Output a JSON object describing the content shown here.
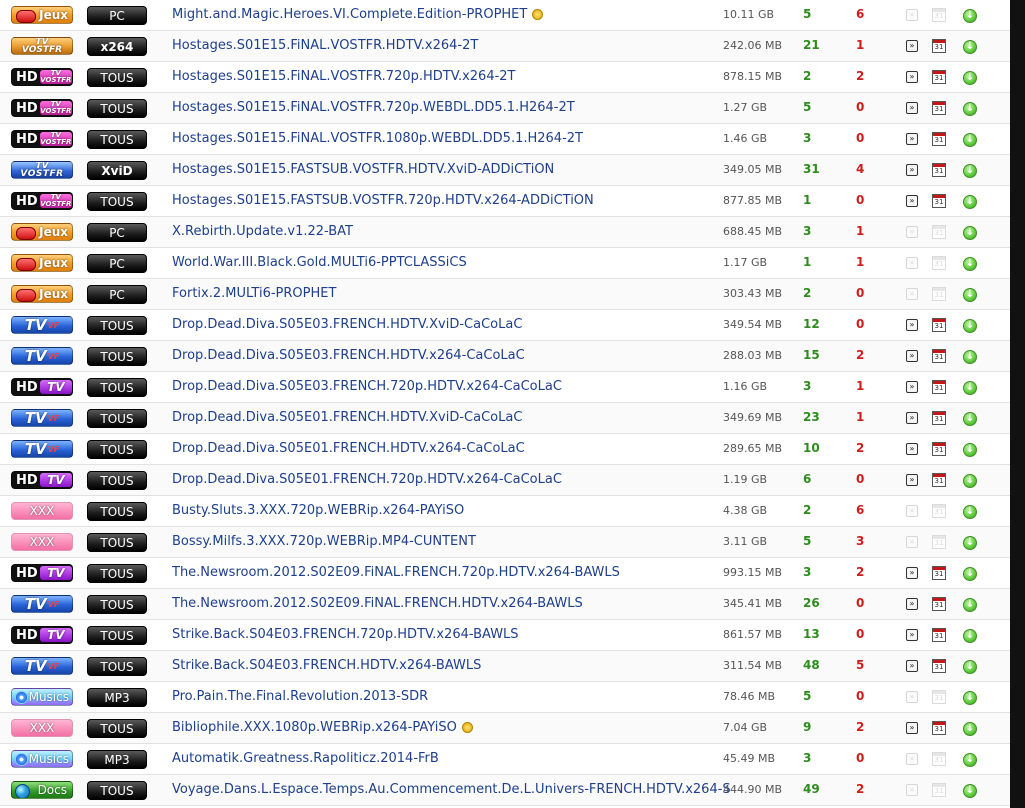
{
  "rows": [
    {
      "cat": "jeux",
      "cat_label": "Jeux",
      "sub": "PC",
      "name": "Might.and.Magic.Heroes.VI.Complete.Edition-PROPHET",
      "star": true,
      "size": "10.11 GB",
      "seeders": "5",
      "leechers": "6",
      "nfo": false
    },
    {
      "cat": "vostfr-orange",
      "cat_label": "VOSTFR",
      "sub": "x264",
      "name": "Hostages.S01E15.FiNAL.VOSTFR.HDTV.x264-2T",
      "star": false,
      "size": "242.06 MB",
      "seeders": "21",
      "leechers": "1",
      "nfo": true
    },
    {
      "cat": "hd-vostfr",
      "cat_label": "HD",
      "sub": "TOUS",
      "name": "Hostages.S01E15.FiNAL.VOSTFR.720p.HDTV.x264-2T",
      "star": false,
      "size": "878.15 MB",
      "seeders": "2",
      "leechers": "2",
      "nfo": true
    },
    {
      "cat": "hd-vostfr",
      "cat_label": "HD",
      "sub": "TOUS",
      "name": "Hostages.S01E15.FiNAL.VOSTFR.720p.WEBDL.DD5.1.H264-2T",
      "star": false,
      "size": "1.27 GB",
      "seeders": "5",
      "leechers": "0",
      "nfo": true
    },
    {
      "cat": "hd-vostfr",
      "cat_label": "HD",
      "sub": "TOUS",
      "name": "Hostages.S01E15.FiNAL.VOSTFR.1080p.WEBDL.DD5.1.H264-2T",
      "star": false,
      "size": "1.46 GB",
      "seeders": "3",
      "leechers": "0",
      "nfo": true
    },
    {
      "cat": "tvvostfr",
      "cat_label": "VOSTFR",
      "sub": "XviD",
      "name": "Hostages.S01E15.FASTSUB.VOSTFR.HDTV.XviD-ADDiCTiON",
      "star": false,
      "size": "349.05 MB",
      "seeders": "31",
      "leechers": "4",
      "nfo": true
    },
    {
      "cat": "hd-vostfr",
      "cat_label": "HD",
      "sub": "TOUS",
      "name": "Hostages.S01E15.FASTSUB.VOSTFR.720p.HDTV.x264-ADDiCTiON",
      "star": false,
      "size": "877.85 MB",
      "seeders": "1",
      "leechers": "0",
      "nfo": true
    },
    {
      "cat": "jeux",
      "cat_label": "Jeux",
      "sub": "PC",
      "name": "X.Rebirth.Update.v1.22-BAT",
      "star": false,
      "size": "688.45 MB",
      "seeders": "3",
      "leechers": "1",
      "nfo": false
    },
    {
      "cat": "jeux",
      "cat_label": "Jeux",
      "sub": "PC",
      "name": "World.War.III.Black.Gold.MULTi6-PPTCLASSiCS",
      "star": false,
      "size": "1.17 GB",
      "seeders": "1",
      "leechers": "1",
      "nfo": false
    },
    {
      "cat": "jeux",
      "cat_label": "Jeux",
      "sub": "PC",
      "name": "Fortix.2.MULTi6-PROPHET",
      "star": false,
      "size": "303.43 MB",
      "seeders": "2",
      "leechers": "0",
      "nfo": false
    },
    {
      "cat": "tv",
      "cat_label": "TV",
      "sub": "TOUS",
      "name": "Drop.Dead.Diva.S05E03.FRENCH.HDTV.XviD-CaCoLaC",
      "star": false,
      "size": "349.54 MB",
      "seeders": "12",
      "leechers": "0",
      "nfo": true
    },
    {
      "cat": "tv",
      "cat_label": "TV",
      "sub": "TOUS",
      "name": "Drop.Dead.Diva.S05E03.FRENCH.HDTV.x264-CaCoLaC",
      "star": false,
      "size": "288.03 MB",
      "seeders": "15",
      "leechers": "2",
      "nfo": true
    },
    {
      "cat": "hd-vf",
      "cat_label": "HD",
      "sub": "TOUS",
      "name": "Drop.Dead.Diva.S05E03.FRENCH.720p.HDTV.x264-CaCoLaC",
      "star": false,
      "size": "1.16 GB",
      "seeders": "3",
      "leechers": "1",
      "nfo": true
    },
    {
      "cat": "tv",
      "cat_label": "TV",
      "sub": "TOUS",
      "name": "Drop.Dead.Diva.S05E01.FRENCH.HDTV.XviD-CaCoLaC",
      "star": false,
      "size": "349.69 MB",
      "seeders": "23",
      "leechers": "1",
      "nfo": true
    },
    {
      "cat": "tv",
      "cat_label": "TV",
      "sub": "TOUS",
      "name": "Drop.Dead.Diva.S05E01.FRENCH.HDTV.x264-CaCoLaC",
      "star": false,
      "size": "289.65 MB",
      "seeders": "10",
      "leechers": "2",
      "nfo": true
    },
    {
      "cat": "hd-vf",
      "cat_label": "HD",
      "sub": "TOUS",
      "name": "Drop.Dead.Diva.S05E01.FRENCH.720p.HDTV.x264-CaCoLaC",
      "star": false,
      "size": "1.19 GB",
      "seeders": "6",
      "leechers": "0",
      "nfo": true
    },
    {
      "cat": "xxx",
      "cat_label": "XXX",
      "sub": "TOUS",
      "name": "Busty.Sluts.3.XXX.720p.WEBRip.x264-PAYiSO",
      "star": false,
      "size": "4.38 GB",
      "seeders": "2",
      "leechers": "6",
      "nfo": false
    },
    {
      "cat": "xxx",
      "cat_label": "XXX",
      "sub": "TOUS",
      "name": "Bossy.Milfs.3.XXX.720p.WEBRip.MP4-CUNTENT",
      "star": false,
      "size": "3.11 GB",
      "seeders": "5",
      "leechers": "3",
      "nfo": false
    },
    {
      "cat": "hd-vf",
      "cat_label": "HD",
      "sub": "TOUS",
      "name": "The.Newsroom.2012.S02E09.FiNAL.FRENCH.720p.HDTV.x264-BAWLS",
      "star": false,
      "size": "993.15 MB",
      "seeders": "3",
      "leechers": "2",
      "nfo": true
    },
    {
      "cat": "tv",
      "cat_label": "TV",
      "sub": "TOUS",
      "name": "The.Newsroom.2012.S02E09.FiNAL.FRENCH.HDTV.x264-BAWLS",
      "star": false,
      "size": "345.41 MB",
      "seeders": "26",
      "leechers": "0",
      "nfo": true
    },
    {
      "cat": "hd-vf",
      "cat_label": "HD",
      "sub": "TOUS",
      "name": "Strike.Back.S04E03.FRENCH.720p.HDTV.x264-BAWLS",
      "star": false,
      "size": "861.57 MB",
      "seeders": "13",
      "leechers": "0",
      "nfo": true
    },
    {
      "cat": "tv",
      "cat_label": "TV",
      "sub": "TOUS",
      "name": "Strike.Back.S04E03.FRENCH.HDTV.x264-BAWLS",
      "star": false,
      "size": "311.54 MB",
      "seeders": "48",
      "leechers": "5",
      "nfo": true
    },
    {
      "cat": "musics",
      "cat_label": "Musics",
      "sub": "MP3",
      "name": "Pro.Pain.The.Final.Revolution.2013-SDR",
      "star": false,
      "size": "78.46 MB",
      "seeders": "5",
      "leechers": "0",
      "nfo": false
    },
    {
      "cat": "xxx",
      "cat_label": "XXX",
      "sub": "TOUS",
      "name": "Bibliophile.XXX.1080p.WEBRip.x264-PAYiSO",
      "star": true,
      "size": "7.04 GB",
      "seeders": "9",
      "leechers": "2",
      "nfo": true
    },
    {
      "cat": "musics",
      "cat_label": "Musics",
      "sub": "MP3",
      "name": "Automatik.Greatness.Rapoliticz.2014-FrB",
      "star": false,
      "size": "45.49 MB",
      "seeders": "3",
      "leechers": "0",
      "nfo": false
    },
    {
      "cat": "docs",
      "cat_label": "Docs",
      "sub": "TOUS",
      "name": "Voyage.Dans.L.Espace.Temps.Au.Commencement.De.L.Univers-FRENCH.HDTV.x264-S",
      "star": false,
      "size": "444.90 MB",
      "seeders": "49",
      "leechers": "2",
      "nfo": false
    }
  ],
  "icons": {
    "nfo": "nfo-icon",
    "calendar": "calendar-icon",
    "calendar_day": "31",
    "download": "download-arrow-icon"
  },
  "colors": {
    "link": "#1e3f8c",
    "seeders": "#2e8b1e",
    "leechers": "#d11c1c"
  }
}
